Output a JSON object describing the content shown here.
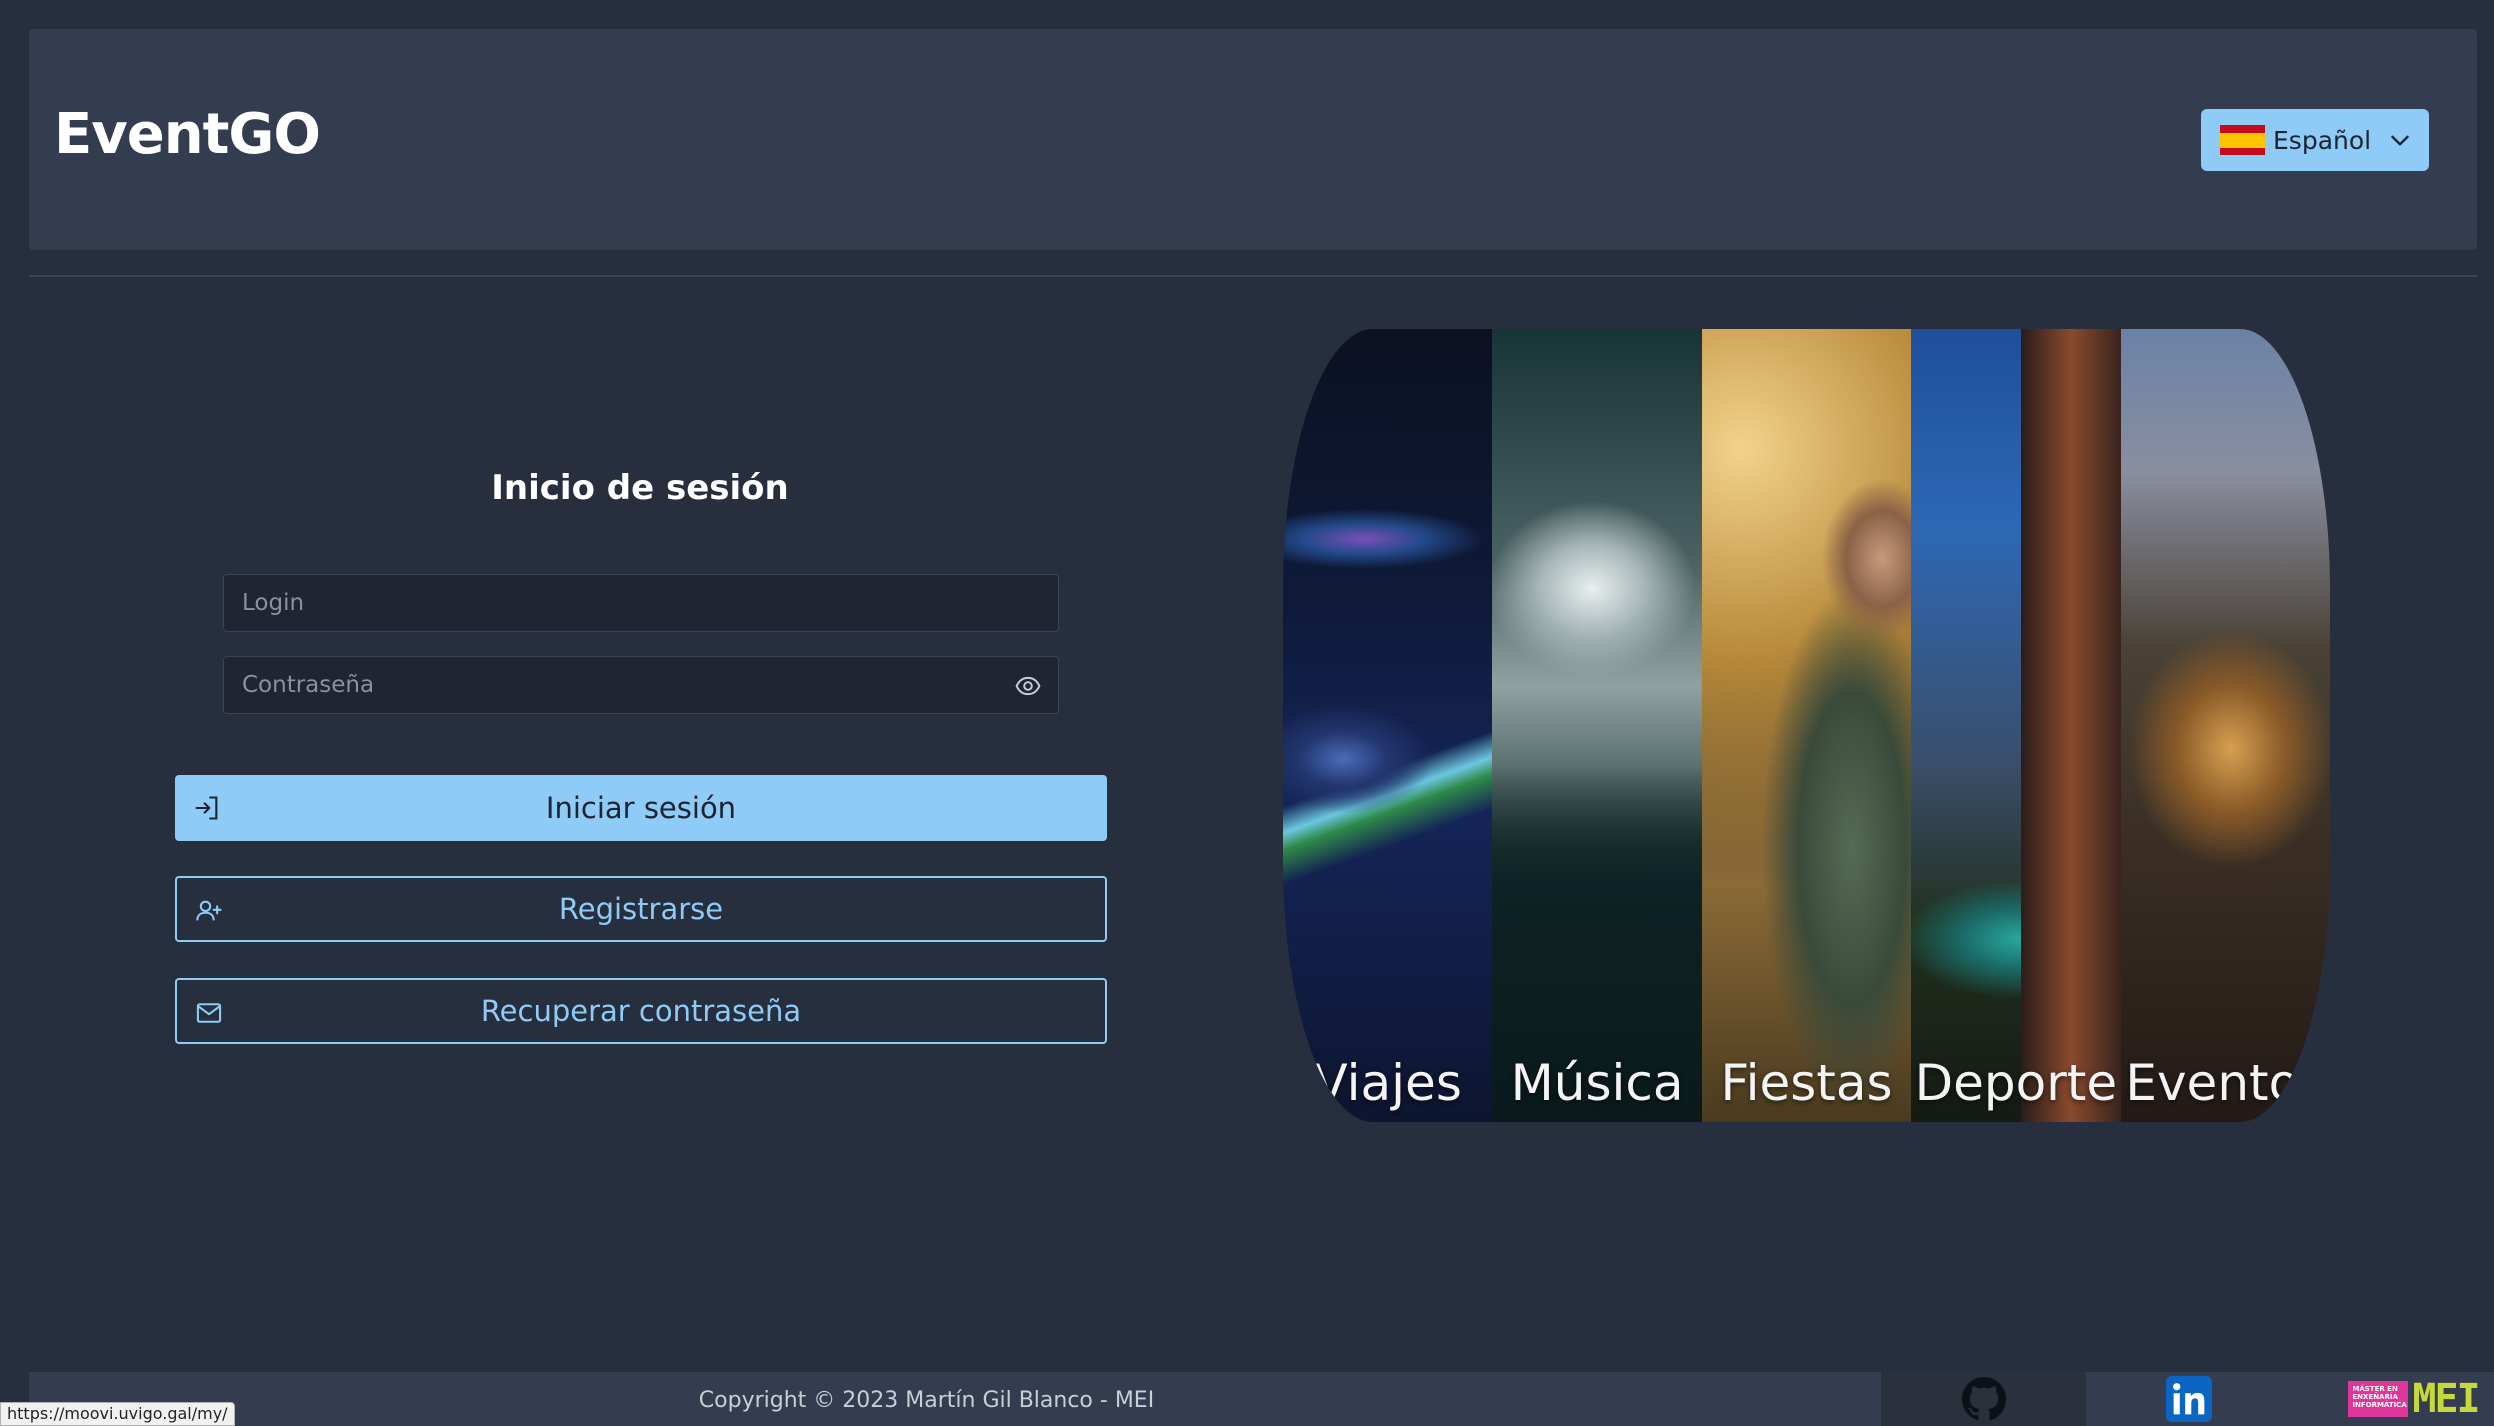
{
  "app": {
    "brand": "EventGO"
  },
  "language": {
    "selected": "Español",
    "flag": "spain-flag",
    "icon": "chevron-down-icon"
  },
  "login": {
    "title": "Inicio de sesión",
    "login_placeholder": "Login",
    "login_value": "",
    "password_placeholder": "Contraseña",
    "password_value": "",
    "show_password_icon": "eye-icon"
  },
  "buttons": {
    "login": {
      "label": "Iniciar sesión",
      "icon": "sign-in-icon"
    },
    "register": {
      "label": "Registrarse",
      "icon": "user-plus-icon"
    },
    "recover": {
      "label": "Recuperar contraseña",
      "icon": "envelope-icon"
    }
  },
  "gallery": {
    "panels": [
      {
        "caption": "Viajes"
      },
      {
        "caption": "Música"
      },
      {
        "caption": "Fiestas"
      },
      {
        "caption": "Deporte"
      },
      {
        "caption": "Eventos"
      }
    ]
  },
  "footer": {
    "copyright": "Copyright © 2023 Martín Gil Blanco - MEI",
    "links": [
      "github-icon",
      "linkedin-icon",
      "mei-logo"
    ],
    "mei_badge": "MÁSTER EN ENXEÑARÍA INFORMÁTICA",
    "mei_text": "MEI"
  },
  "status_bar": {
    "url": "https://moovi.uvigo.gal/my/"
  },
  "colors": {
    "background": "#272e3d",
    "panel": "#343d4f",
    "accent": "#8ecbf7",
    "white": "#ffffff"
  }
}
